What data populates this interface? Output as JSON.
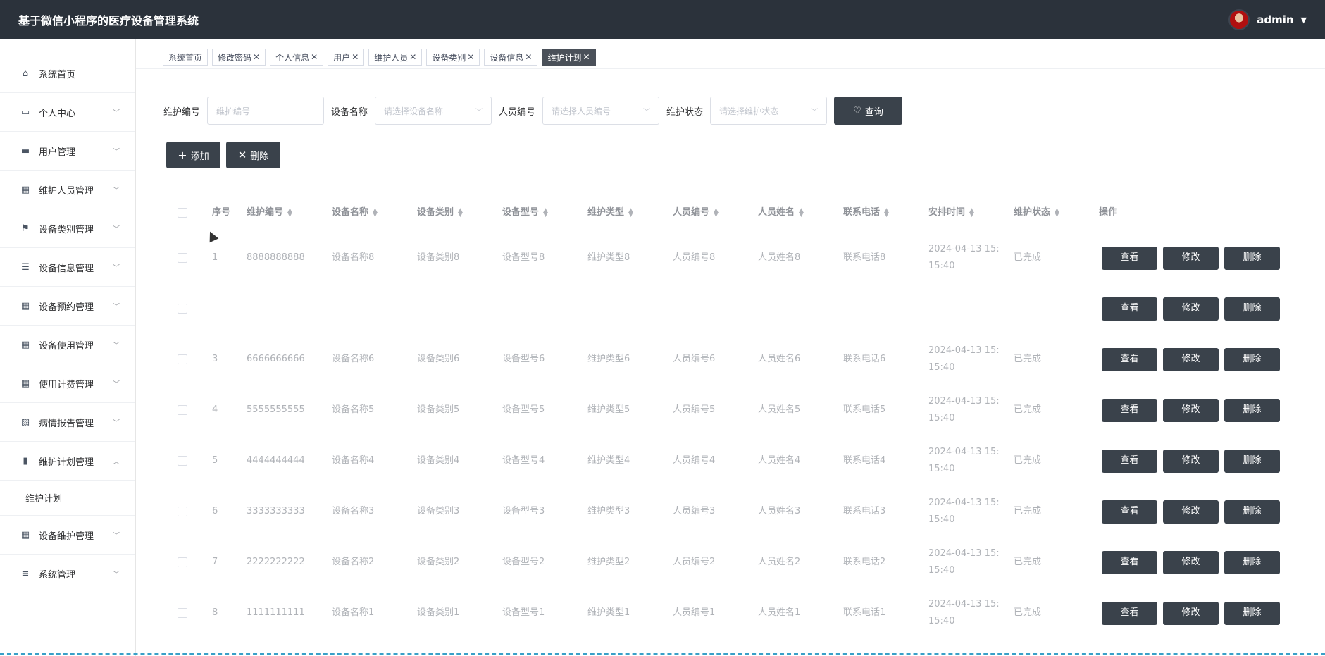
{
  "app_title": "基于微信小程序的医疗设备管理系统",
  "user": {
    "name": "admin"
  },
  "sidebar": {
    "items": [
      {
        "label": "系统首页",
        "icon": "home-icon",
        "has_children": false
      },
      {
        "label": "个人中心",
        "icon": "card-icon",
        "has_children": true
      },
      {
        "label": "用户管理",
        "icon": "chat-icon",
        "has_children": true
      },
      {
        "label": "维护人员管理",
        "icon": "grid-icon",
        "has_children": true
      },
      {
        "label": "设备类别管理",
        "icon": "flag-icon",
        "has_children": true
      },
      {
        "label": "设备信息管理",
        "icon": "sliders-icon",
        "has_children": true
      },
      {
        "label": "设备预约管理",
        "icon": "grid-icon",
        "has_children": true
      },
      {
        "label": "设备使用管理",
        "icon": "grid-icon",
        "has_children": true
      },
      {
        "label": "使用计费管理",
        "icon": "grid-icon",
        "has_children": true
      },
      {
        "label": "病情报告管理",
        "icon": "chart-icon",
        "has_children": true
      },
      {
        "label": "维护计划管理",
        "icon": "calendar-icon",
        "has_children": true,
        "expanded": true
      },
      {
        "label": "设备维护管理",
        "icon": "grid-icon",
        "has_children": true
      },
      {
        "label": "系统管理",
        "icon": "list-icon",
        "has_children": true
      }
    ],
    "subitem": "维护计划"
  },
  "tabs": [
    {
      "label": "系统首页",
      "closable": false
    },
    {
      "label": "修改密码",
      "closable": true
    },
    {
      "label": "个人信息",
      "closable": true
    },
    {
      "label": "用户",
      "closable": true
    },
    {
      "label": "维护人员",
      "closable": true
    },
    {
      "label": "设备类别",
      "closable": true
    },
    {
      "label": "设备信息",
      "closable": true
    },
    {
      "label": "维护计划",
      "closable": true,
      "active": true
    }
  ],
  "search": {
    "f1_label": "维护编号",
    "f1_placeholder": "维护编号",
    "f2_label": "设备名称",
    "f2_placeholder": "请选择设备名称",
    "f3_label": "人员编号",
    "f3_placeholder": "请选择人员编号",
    "f4_label": "维护状态",
    "f4_placeholder": "请选择维护状态",
    "query_label": "查询"
  },
  "toolbar": {
    "add_label": "添加",
    "delete_label": "删除"
  },
  "table": {
    "headers": [
      "序号",
      "维护编号",
      "设备名称",
      "设备类别",
      "设备型号",
      "维护类型",
      "人员编号",
      "人员姓名",
      "联系电话",
      "安排时间",
      "维护状态",
      "操作"
    ],
    "view_label": "查看",
    "edit_label": "修改",
    "delete_label": "删除",
    "rows": [
      {
        "idx": "1",
        "code": "8888888888",
        "name": "设备名称8",
        "cat": "设备类别8",
        "model": "设备型号8",
        "type": "维护类型8",
        "pno": "人员编号8",
        "pname": "人员姓名8",
        "phone": "联系电话8",
        "time_l1": "2024-04-13 15:",
        "time_l2": "15:40",
        "status": "已完成"
      },
      {
        "idx": "",
        "code": "",
        "name": "",
        "cat": "",
        "model": "",
        "type": "",
        "pno": "",
        "pname": "",
        "phone": "",
        "time_l1": "",
        "time_l2": "",
        "status": ""
      },
      {
        "idx": "3",
        "code": "6666666666",
        "name": "设备名称6",
        "cat": "设备类别6",
        "model": "设备型号6",
        "type": "维护类型6",
        "pno": "人员编号6",
        "pname": "人员姓名6",
        "phone": "联系电话6",
        "time_l1": "2024-04-13 15:",
        "time_l2": "15:40",
        "status": "已完成"
      },
      {
        "idx": "4",
        "code": "5555555555",
        "name": "设备名称5",
        "cat": "设备类别5",
        "model": "设备型号5",
        "type": "维护类型5",
        "pno": "人员编号5",
        "pname": "人员姓名5",
        "phone": "联系电话5",
        "time_l1": "2024-04-13 15:",
        "time_l2": "15:40",
        "status": "已完成"
      },
      {
        "idx": "5",
        "code": "4444444444",
        "name": "设备名称4",
        "cat": "设备类别4",
        "model": "设备型号4",
        "type": "维护类型4",
        "pno": "人员编号4",
        "pname": "人员姓名4",
        "phone": "联系电话4",
        "time_l1": "2024-04-13 15:",
        "time_l2": "15:40",
        "status": "已完成"
      },
      {
        "idx": "6",
        "code": "3333333333",
        "name": "设备名称3",
        "cat": "设备类别3",
        "model": "设备型号3",
        "type": "维护类型3",
        "pno": "人员编号3",
        "pname": "人员姓名3",
        "phone": "联系电话3",
        "time_l1": "2024-04-13 15:",
        "time_l2": "15:40",
        "status": "已完成"
      },
      {
        "idx": "7",
        "code": "2222222222",
        "name": "设备名称2",
        "cat": "设备类别2",
        "model": "设备型号2",
        "type": "维护类型2",
        "pno": "人员编号2",
        "pname": "人员姓名2",
        "phone": "联系电话2",
        "time_l1": "2024-04-13 15:",
        "time_l2": "15:40",
        "status": "已完成"
      },
      {
        "idx": "8",
        "code": "1111111111",
        "name": "设备名称1",
        "cat": "设备类别1",
        "model": "设备型号1",
        "type": "维护类型1",
        "pno": "人员编号1",
        "pname": "人员姓名1",
        "phone": "联系电话1",
        "time_l1": "2024-04-13 15:",
        "time_l2": "15:40",
        "status": "已完成"
      }
    ]
  },
  "colors": {
    "topbar": "#2b323b",
    "button": "#3a424b",
    "accent_line": "#39a0c8"
  }
}
